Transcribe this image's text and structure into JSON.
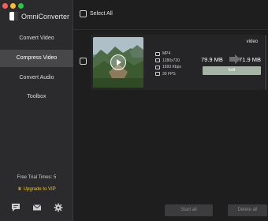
{
  "window": {
    "traffic_lights": [
      "close",
      "minimize",
      "zoom"
    ]
  },
  "app": {
    "name": "OmniConverter"
  },
  "sidebar": {
    "items": [
      {
        "label": "Convert Video",
        "active": false
      },
      {
        "label": "Compress Video",
        "active": true
      },
      {
        "label": "Convert Audio",
        "active": false
      },
      {
        "label": "Toolbox",
        "active": false
      }
    ],
    "trial_text": "Free Trial Times: 5",
    "vip_text": "Upgrade to VIP",
    "bottom_icons": [
      "feedback-icon",
      "mail-icon",
      "gear-icon"
    ]
  },
  "main": {
    "select_all_label": "Select All",
    "file": {
      "title": "video",
      "format": "MP4",
      "resolution": "1280x720",
      "bitrate": "1693 Kbps",
      "fps": "30 FPS",
      "original_size": "79.9 MB",
      "target_size": "71.9 MB",
      "edit_label": "Edit"
    },
    "start_label": "Start all",
    "delete_label": "Delete all"
  },
  "colors": {
    "sidebar_bg": "#2b2b2d",
    "active_bg": "#474749",
    "main_bg": "#1e1e1e",
    "card_bg": "#252527",
    "vip_accent": "#f0c030",
    "edit_button": "#a6b4a8"
  }
}
